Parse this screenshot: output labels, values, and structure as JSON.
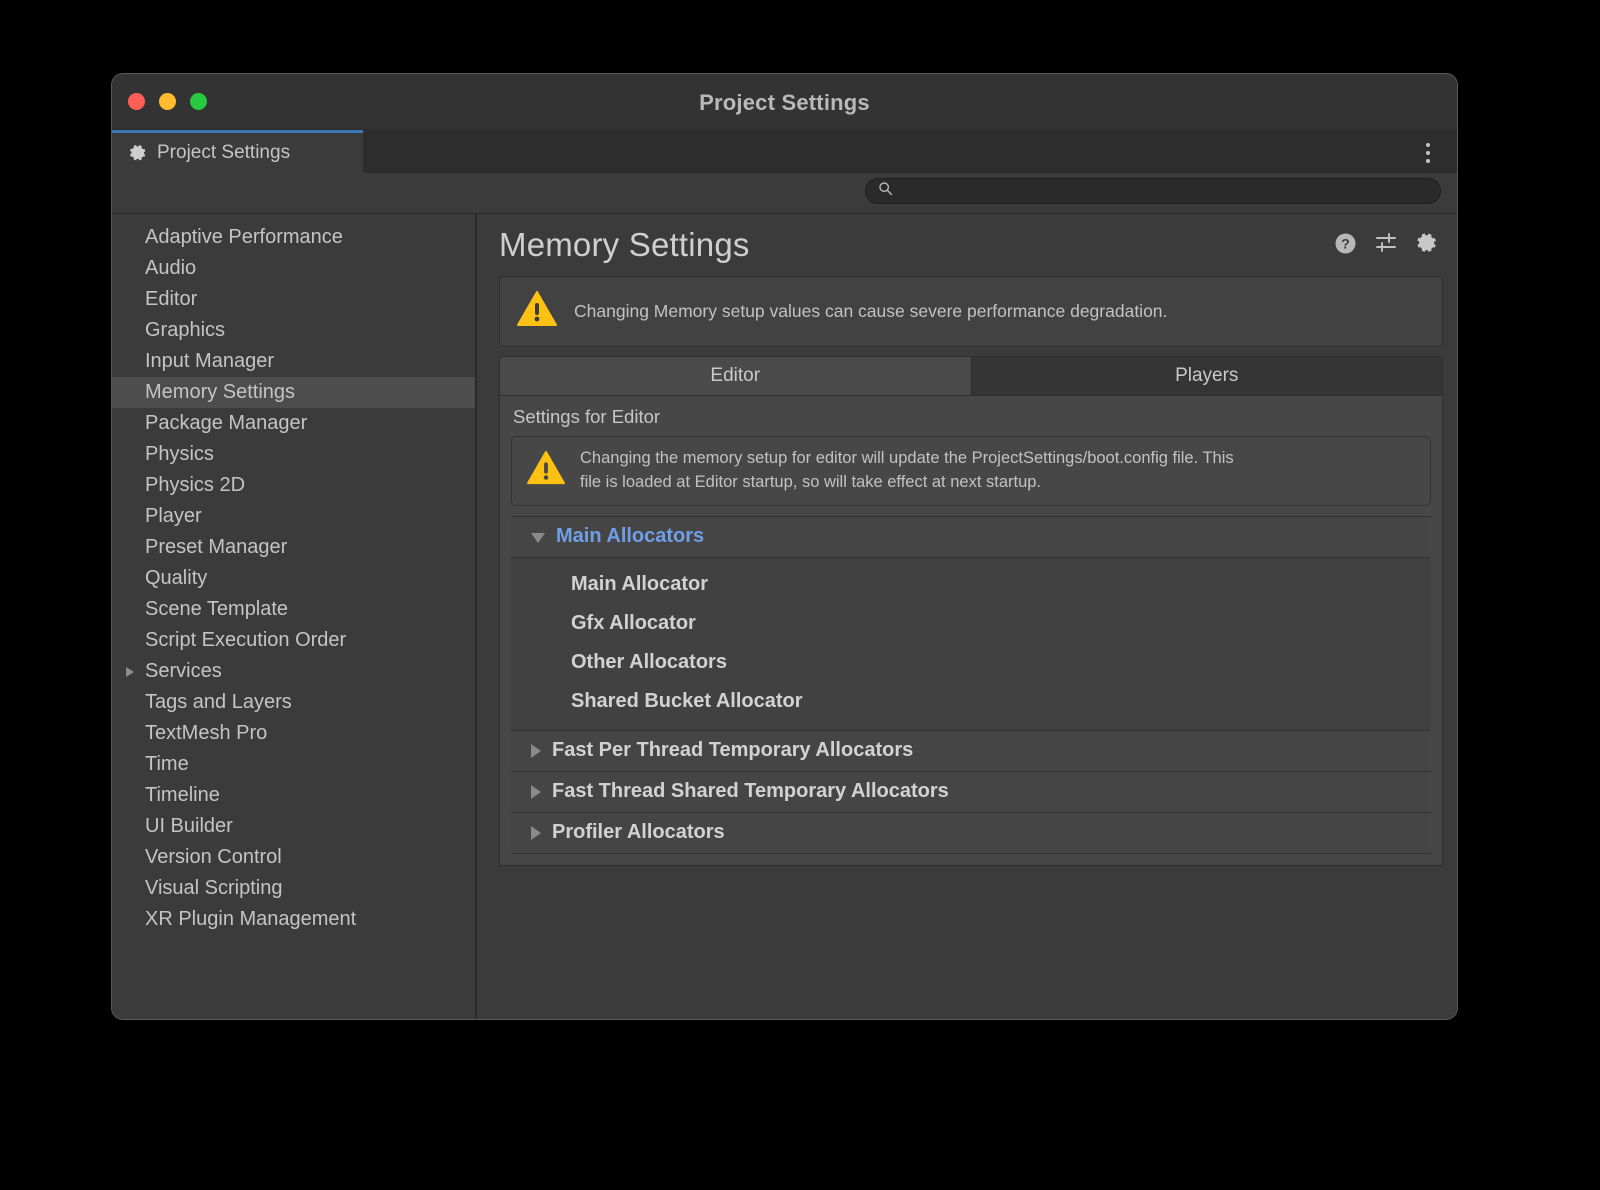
{
  "window": {
    "title": "Project Settings",
    "traffic_lights": [
      "close-button",
      "minimize-button",
      "zoom-button"
    ]
  },
  "tabstrip": {
    "tab_label": "Project Settings",
    "tab_icon": "gear-icon",
    "overflow_icon": "kebab-menu-icon"
  },
  "search": {
    "value": "",
    "placeholder": "",
    "icon": "search-icon"
  },
  "sidebar": {
    "items": [
      {
        "label": "Adaptive Performance",
        "selected": false,
        "expandable": false
      },
      {
        "label": "Audio",
        "selected": false,
        "expandable": false
      },
      {
        "label": "Editor",
        "selected": false,
        "expandable": false
      },
      {
        "label": "Graphics",
        "selected": false,
        "expandable": false
      },
      {
        "label": "Input Manager",
        "selected": false,
        "expandable": false
      },
      {
        "label": "Memory Settings",
        "selected": true,
        "expandable": false
      },
      {
        "label": "Package Manager",
        "selected": false,
        "expandable": false
      },
      {
        "label": "Physics",
        "selected": false,
        "expandable": false
      },
      {
        "label": "Physics 2D",
        "selected": false,
        "expandable": false
      },
      {
        "label": "Player",
        "selected": false,
        "expandable": false
      },
      {
        "label": "Preset Manager",
        "selected": false,
        "expandable": false
      },
      {
        "label": "Quality",
        "selected": false,
        "expandable": false
      },
      {
        "label": "Scene Template",
        "selected": false,
        "expandable": false
      },
      {
        "label": "Script Execution Order",
        "selected": false,
        "expandable": false
      },
      {
        "label": "Services",
        "selected": false,
        "expandable": true
      },
      {
        "label": "Tags and Layers",
        "selected": false,
        "expandable": false
      },
      {
        "label": "TextMesh Pro",
        "selected": false,
        "expandable": false
      },
      {
        "label": "Time",
        "selected": false,
        "expandable": false
      },
      {
        "label": "Timeline",
        "selected": false,
        "expandable": false
      },
      {
        "label": "UI Builder",
        "selected": false,
        "expandable": false
      },
      {
        "label": "Version Control",
        "selected": false,
        "expandable": false
      },
      {
        "label": "Visual Scripting",
        "selected": false,
        "expandable": false
      },
      {
        "label": "XR Plugin Management",
        "selected": false,
        "expandable": false
      }
    ]
  },
  "main": {
    "title": "Memory Settings",
    "header_icons": [
      "help-icon",
      "preset-sliders-icon",
      "gear-icon"
    ],
    "top_warning": {
      "icon": "warning-triangle-icon",
      "text": "Changing Memory setup values can cause severe performance degradation."
    },
    "tabs": [
      {
        "label": "Editor",
        "active": true
      },
      {
        "label": "Players",
        "active": false
      }
    ],
    "panel_caption": "Settings for Editor",
    "inner_warning": {
      "icon": "warning-triangle-icon",
      "line1": "Changing the memory setup for editor will update the ProjectSettings/boot.config file. This",
      "line2": "file is loaded at Editor startup, so will take effect at next startup."
    },
    "foldouts": [
      {
        "label": "Main Allocators",
        "expanded": true,
        "accent": true
      },
      {
        "label": "Fast Per Thread Temporary Allocators",
        "expanded": false,
        "accent": false
      },
      {
        "label": "Fast Thread Shared Temporary Allocators",
        "expanded": false,
        "accent": false
      },
      {
        "label": "Profiler Allocators",
        "expanded": false,
        "accent": false
      }
    ],
    "main_allocator_children": [
      {
        "label": "Main Allocator",
        "expanded": false
      },
      {
        "label": "Gfx Allocator",
        "expanded": false
      },
      {
        "label": "Other Allocators",
        "expanded": false
      },
      {
        "label": "Shared Bucket Allocator",
        "expanded": false
      }
    ]
  },
  "colors": {
    "accent_blue": "#6f9fe8",
    "tab_underline": "#3d7ab5",
    "warning_yellow": "#ffc107",
    "window_bg": "#3b3b3b",
    "selected_row": "#4d4d4d"
  }
}
